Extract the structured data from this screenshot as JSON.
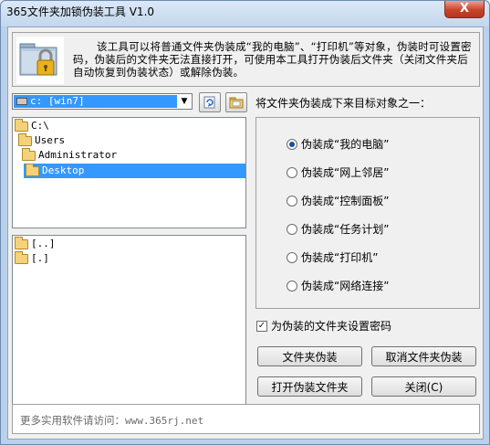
{
  "window": {
    "title": "365文件夹加锁伪装工具 V1.0",
    "close_glyph": "X"
  },
  "header": {
    "description": "该工具可以将普通文件夹伪装成“我的电脑”、“打印机”等对象，伪装时可设置密码，伪装后的文件夹无法直接打开，可使用本工具打开伪装后文件夹（关闭文件夹后自动恢复到伪装状态）或解除伪装。",
    "logo_icon": "folder-lock-icon"
  },
  "drive": {
    "selected": "c: [win7]",
    "icons": [
      "drive-icon",
      "chevron-down-icon"
    ]
  },
  "toolbar": {
    "icons": [
      "refresh-icon",
      "folder-open-icon"
    ]
  },
  "target_label": "将文件夹伪装成下来目标对象之一：",
  "tree": {
    "items": [
      {
        "label": "C:\\",
        "level": 0,
        "selected": false
      },
      {
        "label": "Users",
        "level": 1,
        "selected": false
      },
      {
        "label": "Administrator",
        "level": 2,
        "selected": false
      },
      {
        "label": "Desktop",
        "level": 3,
        "selected": true
      }
    ]
  },
  "files": {
    "items": [
      {
        "label": "[..]"
      },
      {
        "label": "[.]"
      }
    ]
  },
  "options": {
    "items": [
      {
        "label": "伪装成“我的电脑”",
        "checked": true
      },
      {
        "label": "伪装成“网上邻居”",
        "checked": false
      },
      {
        "label": "伪装成“控制面板”",
        "checked": false
      },
      {
        "label": "伪装成“任务计划”",
        "checked": false
      },
      {
        "label": "伪装成“打印机”",
        "checked": false
      },
      {
        "label": "伪装成“网络连接”",
        "checked": false
      }
    ]
  },
  "password_checkbox": {
    "label": "为伪装的文件夹设置密码",
    "checked": true,
    "mark": "✓"
  },
  "buttons": {
    "disguise": "文件夹伪装",
    "cancel_disguise": "取消文件夹伪装",
    "open_disguised": "打开伪装文件夹",
    "close": "关闭(C)"
  },
  "footer": {
    "text": "更多实用软件请访问：",
    "url": "www.365rj.net"
  }
}
